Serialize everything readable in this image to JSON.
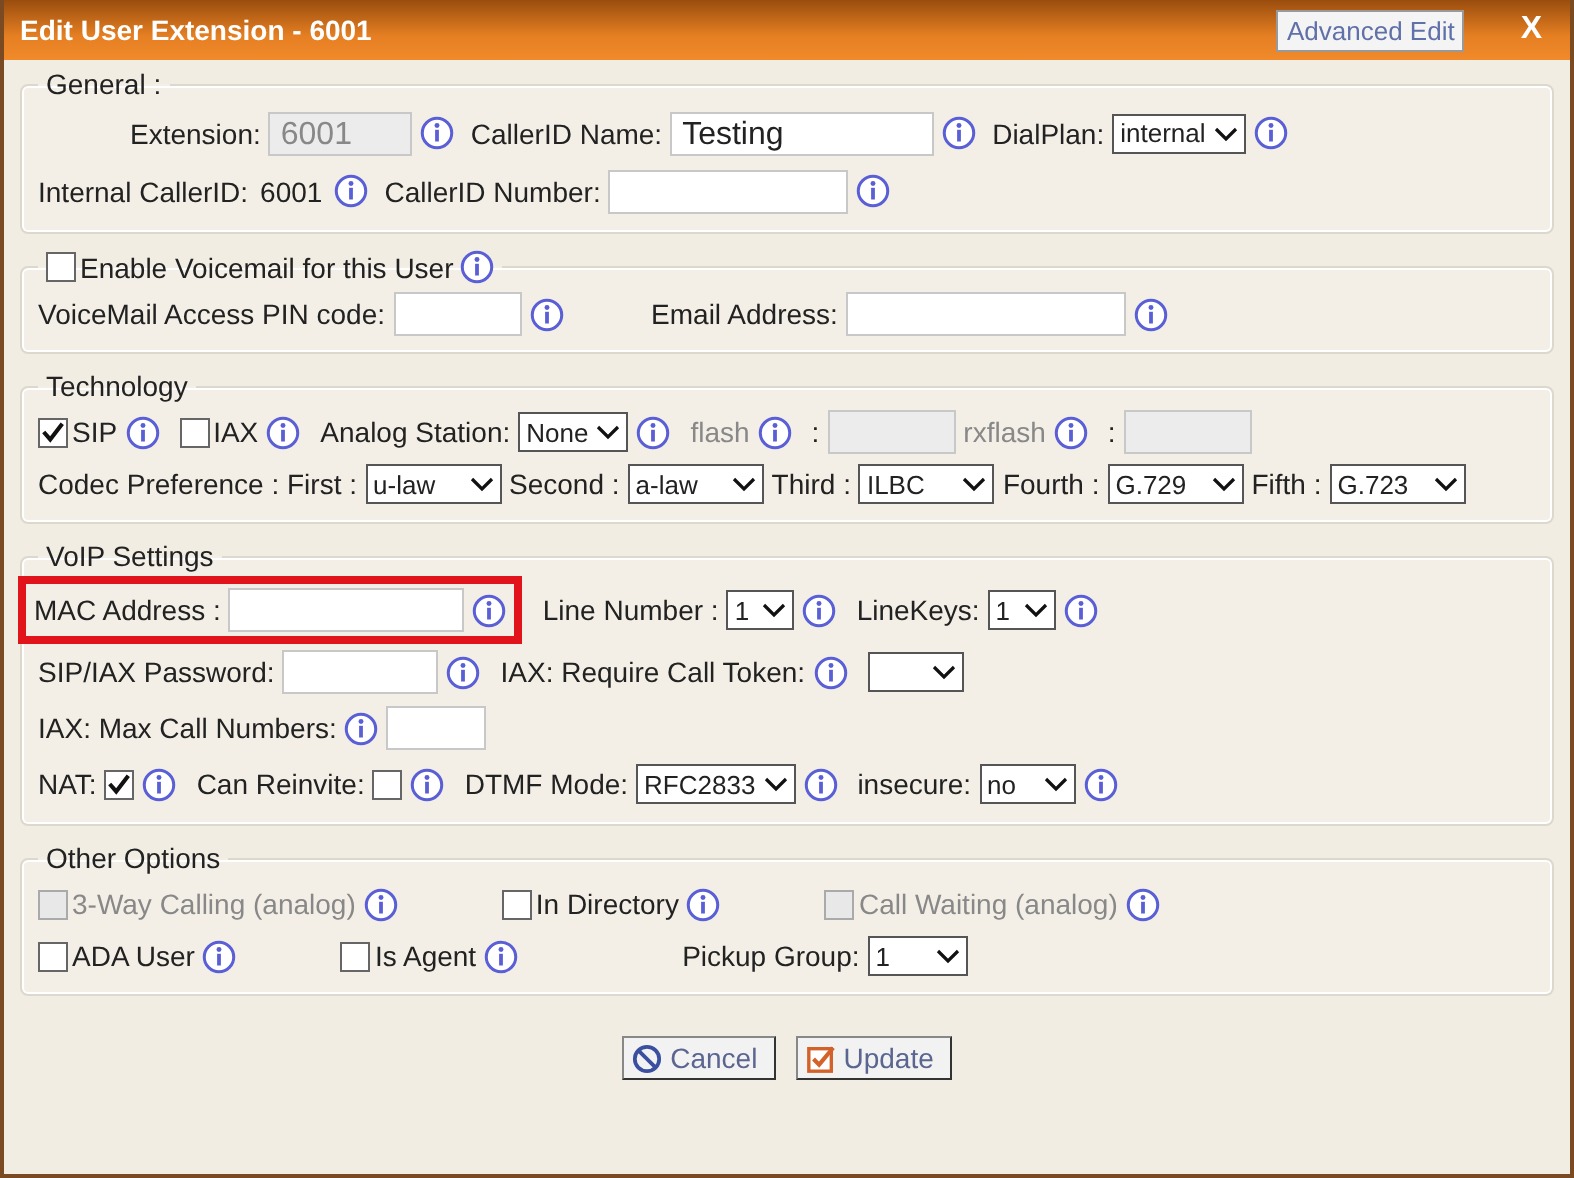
{
  "window": {
    "title": "Edit User Extension - 6001",
    "advanced_button": "Advanced Edit",
    "close": "X"
  },
  "sections": [
    {
      "legend": [
        {
          "kind": "label",
          "text": "General :"
        }
      ],
      "rows": [
        {
          "items": [
            {
              "kind": "label",
              "text": "Extension:"
            },
            {
              "kind": "input",
              "value": "6001",
              "disabled": true
            },
            {
              "kind": "info"
            },
            {
              "kind": "label",
              "text": "CallerID Name:"
            },
            {
              "kind": "input",
              "value": "Testing",
              "disabled": false
            },
            {
              "kind": "info"
            },
            {
              "kind": "label",
              "text": "DialPlan:"
            },
            {
              "kind": "select",
              "value": "internal"
            },
            {
              "kind": "info"
            }
          ]
        },
        {
          "items": [
            {
              "kind": "label",
              "text": "Internal CallerID:"
            },
            {
              "kind": "text",
              "text": "6001"
            },
            {
              "kind": "info"
            },
            {
              "kind": "label",
              "text": "CallerID Number:"
            },
            {
              "kind": "input",
              "disabled": false
            },
            {
              "kind": "info"
            }
          ]
        }
      ]
    },
    {
      "legend": [
        {
          "kind": "checkbox",
          "label": "Enable Voicemail for this User",
          "checked": false,
          "disabled": false
        },
        {
          "kind": "info"
        }
      ],
      "rows": [
        {
          "items": [
            {
              "kind": "label",
              "text": "VoiceMail Access PIN code:"
            },
            {
              "kind": "input",
              "disabled": false
            },
            {
              "kind": "info"
            },
            {
              "kind": "label",
              "text": "Email Address:"
            },
            {
              "kind": "input",
              "disabled": false
            },
            {
              "kind": "info"
            }
          ]
        }
      ]
    },
    {
      "legend": [
        {
          "kind": "label",
          "text": "Technology"
        }
      ],
      "rows": [
        {
          "items": [
            {
              "kind": "checkbox",
              "label": "SIP",
              "checked": true,
              "disabled": false
            },
            {
              "kind": "info"
            },
            {
              "kind": "checkbox",
              "label": "IAX",
              "checked": false,
              "disabled": false
            },
            {
              "kind": "info"
            },
            {
              "kind": "label",
              "text": "Analog Station:"
            },
            {
              "kind": "select",
              "value": "None"
            },
            {
              "kind": "info"
            },
            {
              "kind": "label",
              "text": "flash",
              "disabled": true
            },
            {
              "kind": "info"
            },
            {
              "kind": "label",
              "text": ":"
            },
            {
              "kind": "input",
              "disabled": true
            },
            {
              "kind": "label",
              "text": "rxflash",
              "disabled": true
            },
            {
              "kind": "info"
            },
            {
              "kind": "label",
              "text": ":"
            },
            {
              "kind": "input",
              "disabled": true
            }
          ]
        },
        {
          "items": [
            {
              "kind": "label",
              "text": "Codec Preference : First :"
            },
            {
              "kind": "select",
              "value": "u-law"
            },
            {
              "kind": "label",
              "text": "Second :"
            },
            {
              "kind": "select",
              "value": "a-law"
            },
            {
              "kind": "label",
              "text": "Third :"
            },
            {
              "kind": "select",
              "value": "ILBC"
            },
            {
              "kind": "label",
              "text": "Fourth :"
            },
            {
              "kind": "select",
              "value": "G.729"
            },
            {
              "kind": "label",
              "text": "Fifth :"
            },
            {
              "kind": "select",
              "value": "G.723"
            }
          ]
        }
      ]
    },
    {
      "legend": [
        {
          "kind": "label",
          "text": "VoIP Settings"
        }
      ],
      "rows": [
        {
          "items": [
            {
              "kind": "highlight",
              "items": [
                {
                  "kind": "label",
                  "text": "MAC Address :"
                },
                {
                  "kind": "input",
                  "disabled": false
                },
                {
                  "kind": "info"
                }
              ]
            },
            {
              "kind": "label",
              "text": "Line Number :"
            },
            {
              "kind": "select",
              "value": "1"
            },
            {
              "kind": "info"
            },
            {
              "kind": "label",
              "text": "LineKeys:"
            },
            {
              "kind": "select",
              "value": "1"
            },
            {
              "kind": "info"
            }
          ]
        },
        {
          "items": [
            {
              "kind": "label",
              "text": "SIP/IAX Password:"
            },
            {
              "kind": "input",
              "disabled": false
            },
            {
              "kind": "info"
            },
            {
              "kind": "label",
              "text": "IAX: Require Call Token:"
            },
            {
              "kind": "info"
            },
            {
              "kind": "select"
            }
          ]
        },
        {
          "items": [
            {
              "kind": "label",
              "text": "IAX: Max Call Numbers:"
            },
            {
              "kind": "info"
            },
            {
              "kind": "input",
              "disabled": false
            }
          ]
        },
        {
          "items": [
            {
              "kind": "label",
              "text": "NAT:"
            },
            {
              "kind": "checkbox",
              "checked": true,
              "disabled": false
            },
            {
              "kind": "info"
            },
            {
              "kind": "label",
              "text": "Can Reinvite:"
            },
            {
              "kind": "checkbox",
              "checked": false,
              "disabled": false
            },
            {
              "kind": "info"
            },
            {
              "kind": "label",
              "text": "DTMF Mode:"
            },
            {
              "kind": "select",
              "value": "RFC2833"
            },
            {
              "kind": "info"
            },
            {
              "kind": "label",
              "text": "insecure:"
            },
            {
              "kind": "select",
              "value": "no"
            },
            {
              "kind": "info"
            }
          ]
        }
      ]
    },
    {
      "legend": [
        {
          "kind": "label",
          "text": "Other Options"
        }
      ],
      "rows": [
        {
          "items": [
            {
              "kind": "checkbox",
              "label": "3-Way Calling (analog)",
              "checked": false,
              "disabled": true
            },
            {
              "kind": "info"
            },
            {
              "kind": "checkbox",
              "label": "In Directory",
              "checked": false,
              "disabled": false
            },
            {
              "kind": "info"
            },
            {
              "kind": "checkbox",
              "label": "Call Waiting (analog)",
              "checked": false,
              "disabled": true
            },
            {
              "kind": "info"
            }
          ]
        },
        {
          "items": [
            {
              "kind": "checkbox",
              "label": "ADA User",
              "checked": false,
              "disabled": false
            },
            {
              "kind": "info"
            },
            {
              "kind": "checkbox",
              "label": "Is Agent",
              "checked": false,
              "disabled": false
            },
            {
              "kind": "info"
            },
            {
              "kind": "label",
              "text": "Pickup Group:"
            },
            {
              "kind": "select",
              "value": "1"
            }
          ]
        }
      ]
    }
  ],
  "buttons": [
    {
      "kind": "cancel",
      "label": "Cancel"
    },
    {
      "kind": "update",
      "label": "Update"
    }
  ]
}
